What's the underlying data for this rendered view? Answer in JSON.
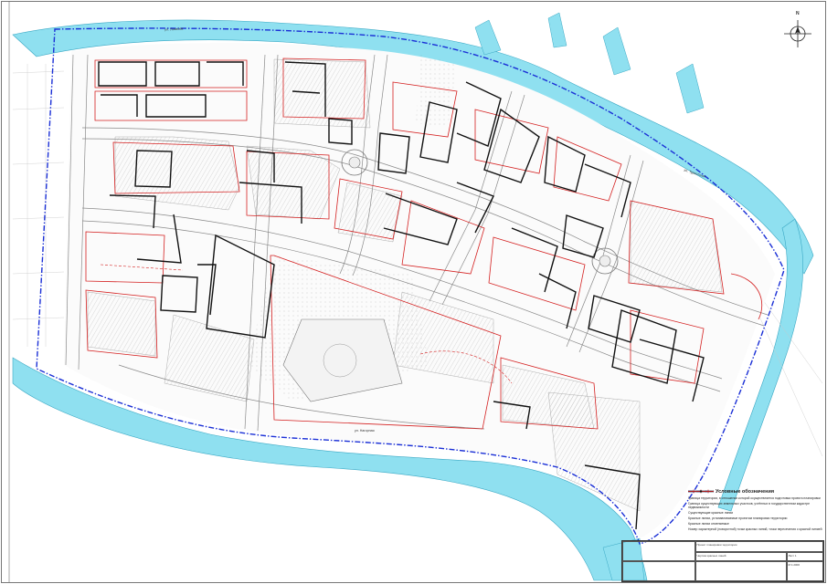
{
  "map": {
    "title": "Условные обозначения",
    "north_label": "N",
    "colors": {
      "water": "#8fe0f0",
      "boundary": "#1a2fd6",
      "red_line": "#d42020",
      "building": "#111111",
      "road": "#8a8a8a",
      "hatch": "#9a9a9a"
    },
    "road_labels": [
      {
        "text": "ул. Ушакова",
        "angle": -3
      },
      {
        "text": "ул. Туристская",
        "angle": 18
      },
      {
        "text": "ул. Нагорная",
        "angle": 0
      }
    ]
  },
  "legend": {
    "title": "Условные обозначения",
    "items": [
      {
        "swatch": "boundary",
        "text": "Граница территории, в отношении которой осуществляется подготовка проекта планировки"
      },
      {
        "swatch": "thin",
        "text": "Граница существующих земельных участков, учтённых в государственном кадастре недвижимости"
      },
      {
        "swatch": "red",
        "text": "Существующие красные линии"
      },
      {
        "swatch": "dark",
        "text": "Красные линии, устанавливаемые проектом планировки территории"
      },
      {
        "swatch": "redtick",
        "text": "Красные линии отменяемые"
      },
      {
        "swatch": "none",
        "text": "Номер характерной (поворотной) точки красных линий, точки пересечения с красной линией"
      }
    ]
  },
  "stamp": {
    "project": "Проект планировки территории",
    "subtitle": "Чертёж красных линий",
    "sheet": "Лист 1",
    "scale": "М 1:2000"
  }
}
